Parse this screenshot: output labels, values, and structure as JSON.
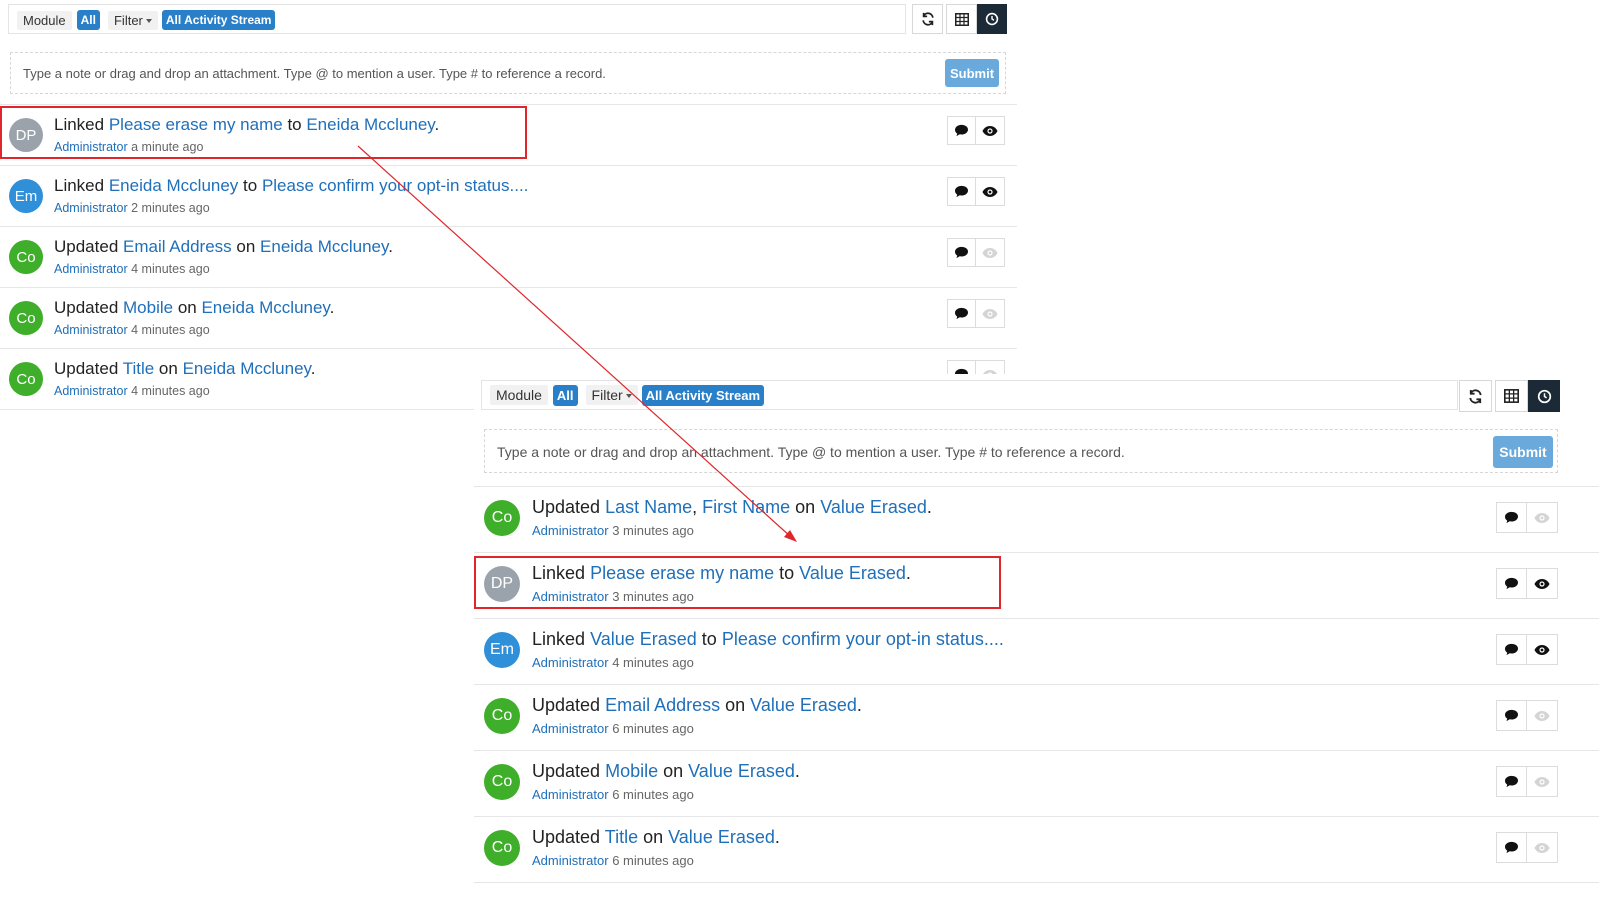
{
  "colors": {
    "link": "#1f6fb9",
    "pill": "#2a7fc9",
    "submit": "#6aa9dc",
    "active_button": "#1b2a36",
    "annotation": "#e0262b",
    "avatar_dp": "#9aa3ab",
    "avatar_em": "#2f8fd8",
    "avatar_co": "#3fae2a"
  },
  "icons": {
    "refresh": "refresh-icon",
    "grid": "table-icon",
    "clock": "clock-icon",
    "comment": "comment-icon",
    "eye": "eye-icon"
  },
  "panels": [
    {
      "toolbar": {
        "module_label": "Module",
        "module_value": "All",
        "filter_label": "Filter",
        "filter_value": "All Activity Stream"
      },
      "composer": {
        "placeholder": "Type a note or drag and drop an attachment. Type @ to mention a user. Type # to reference a record.",
        "submit_label": "Submit"
      },
      "rows": [
        {
          "avatar": "DP",
          "avatar_color": "#9aa3ab",
          "verb": "Linked",
          "link1": "Please erase my name",
          "sep1": " to ",
          "link2": "Eneida Mccluney",
          "tail": ".",
          "user": "Administrator",
          "time": "a minute ago",
          "eye_active": true
        },
        {
          "avatar": "Em",
          "avatar_color": "#2f8fd8",
          "verb": "Linked",
          "link1": "Eneida Mccluney",
          "sep1": " to ",
          "link2": "Please confirm your opt-in status....",
          "tail": "",
          "user": "Administrator",
          "time": "2 minutes ago",
          "eye_active": true
        },
        {
          "avatar": "Co",
          "avatar_color": "#3fae2a",
          "verb": "Updated",
          "link1": "Email Address",
          "sep1": " on ",
          "link2": "Eneida Mccluney",
          "tail": ".",
          "user": "Administrator",
          "time": "4 minutes ago",
          "eye_active": false
        },
        {
          "avatar": "Co",
          "avatar_color": "#3fae2a",
          "verb": "Updated",
          "link1": "Mobile",
          "sep1": " on ",
          "link2": "Eneida Mccluney",
          "tail": ".",
          "user": "Administrator",
          "time": "4 minutes ago",
          "eye_active": false
        },
        {
          "avatar": "Co",
          "avatar_color": "#3fae2a",
          "verb": "Updated",
          "link1": "Title",
          "sep1": " on ",
          "link2": "Eneida Mccluney",
          "tail": ".",
          "user": "Administrator",
          "time": "4 minutes ago",
          "eye_active": false
        }
      ]
    },
    {
      "toolbar": {
        "module_label": "Module",
        "module_value": "All",
        "filter_label": "Filter",
        "filter_value": "All Activity Stream"
      },
      "composer": {
        "placeholder": "Type a note or drag and drop an attachment. Type @ to mention a user. Type # to reference a record.",
        "submit_label": "Submit"
      },
      "rows": [
        {
          "avatar": "Co",
          "avatar_color": "#3fae2a",
          "verb": "Updated",
          "link1": "Last Name",
          "mid": ", ",
          "link1b": "First Name",
          "sep1": " on ",
          "link2": "Value Erased",
          "tail": ".",
          "user": "Administrator",
          "time": "3 minutes ago",
          "eye_active": false
        },
        {
          "avatar": "DP",
          "avatar_color": "#9aa3ab",
          "verb": "Linked",
          "link1": "Please erase my name",
          "sep1": " to ",
          "link2": "Value Erased",
          "tail": ".",
          "user": "Administrator",
          "time": "3 minutes ago",
          "eye_active": true
        },
        {
          "avatar": "Em",
          "avatar_color": "#2f8fd8",
          "verb": "Linked",
          "link1": "Value Erased",
          "sep1": " to ",
          "link2": "Please confirm your opt-in status....",
          "tail": "",
          "user": "Administrator",
          "time": "4 minutes ago",
          "eye_active": true
        },
        {
          "avatar": "Co",
          "avatar_color": "#3fae2a",
          "verb": "Updated",
          "link1": "Email Address",
          "sep1": " on ",
          "link2": "Value Erased",
          "tail": ".",
          "user": "Administrator",
          "time": "6 minutes ago",
          "eye_active": false
        },
        {
          "avatar": "Co",
          "avatar_color": "#3fae2a",
          "verb": "Updated",
          "link1": "Mobile",
          "sep1": " on ",
          "link2": "Value Erased",
          "tail": ".",
          "user": "Administrator",
          "time": "6 minutes ago",
          "eye_active": false
        },
        {
          "avatar": "Co",
          "avatar_color": "#3fae2a",
          "verb": "Updated",
          "link1": "Title",
          "sep1": " on ",
          "link2": "Value Erased",
          "tail": ".",
          "user": "Administrator",
          "time": "6 minutes ago",
          "eye_active": false
        }
      ]
    }
  ]
}
